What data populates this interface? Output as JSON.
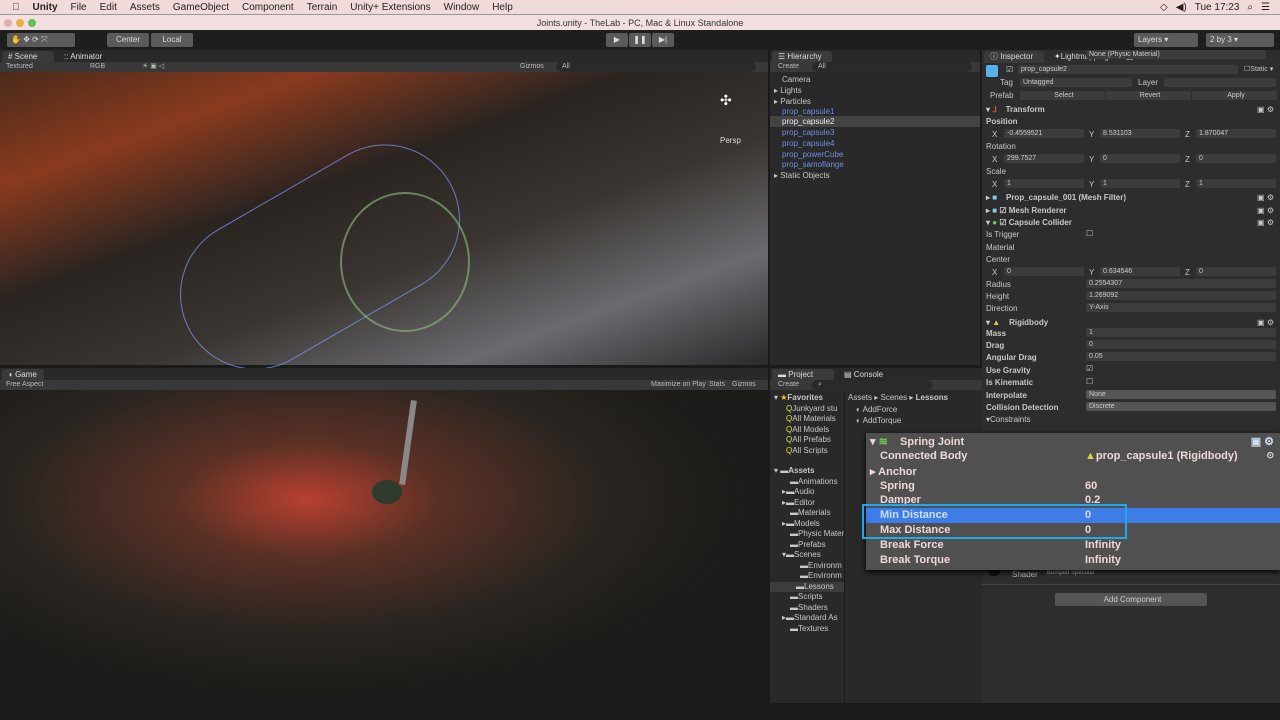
{
  "menu": {
    "apple": "",
    "items": [
      "Unity",
      "File",
      "Edit",
      "Assets",
      "GameObject",
      "Component",
      "Terrain",
      "Unity+ Extensions",
      "Window",
      "Help"
    ],
    "clock": "Tue 17:23"
  },
  "window_title": "Joints.unity - TheLab - PC, Mac & Linux Standalone",
  "toolbar": {
    "center": "Center",
    "local": "Local",
    "layers": "Layers",
    "layout": "2 by 3"
  },
  "scene": {
    "tab": "Scene",
    "tab2": "Animator",
    "shading": "Textured",
    "render": "RGB",
    "gizmos": "Gizmos",
    "search": "All",
    "persp": "Persp"
  },
  "game": {
    "tab": "Game",
    "aspect": "Free Aspect",
    "maximize": "Maximize on Play",
    "stats": "Stats",
    "gizmos": "Gizmos"
  },
  "hierarchy": {
    "tab": "Hierarchy",
    "create": "Create",
    "search": "All",
    "items": [
      {
        "label": "Camera"
      },
      {
        "label": "Lights"
      },
      {
        "label": "Particles"
      },
      {
        "label": "prop_capsule1"
      },
      {
        "label": "prop_capsule2"
      },
      {
        "label": "prop_capsule3"
      },
      {
        "label": "prop_capsule4"
      },
      {
        "label": "prop_powerCube"
      },
      {
        "label": "prop_samoflange"
      },
      {
        "label": "Static Objects"
      }
    ]
  },
  "project": {
    "tab": "Project",
    "tab2": "Console",
    "create": "Create",
    "breadcrumb": [
      "Assets",
      "Scenes",
      "Lessons"
    ],
    "favorites": "Favorites",
    "fav_items": [
      "Junkyard stu",
      "All Materials",
      "All Models",
      "All Prefabs",
      "All Scripts"
    ],
    "assets": "Assets",
    "folders": [
      "Animations",
      "Audio",
      "Editor",
      "Materials",
      "Models",
      "Physic Mater",
      "Prefabs",
      "Scenes",
      "Environm",
      "Environm",
      "Lessons",
      "Scripts",
      "Shaders",
      "Standard As",
      "Textures"
    ],
    "files": [
      "AddForce",
      "AddTorque"
    ]
  },
  "inspector": {
    "tab": "Inspector",
    "tab2": "Lightmapping",
    "tab3": "Occlusion",
    "object_name": "prop_capsule2",
    "static": "Static",
    "tag_label": "Tag",
    "tag": "Untagged",
    "layer_label": "Layer",
    "prefab": "Prefab",
    "select": "Select",
    "revert": "Revert",
    "apply": "Apply",
    "transform": "Transform",
    "position": "Position",
    "rotation": "Rotation",
    "scale": "Scale",
    "pos": [
      "-0.4559521",
      "8.531103",
      "1.870047"
    ],
    "rot": [
      "299.7527",
      "0",
      "0"
    ],
    "scl": [
      "1",
      "1",
      "1"
    ],
    "mesh_filter": "Prop_capsule_001 (Mesh Filter)",
    "mesh_renderer": "Mesh Renderer",
    "capsule_collider": "Capsule Collider",
    "is_trigger": "Is Trigger",
    "material": "Material",
    "material_val": "None (Physic Material)",
    "center": "Center",
    "center_v": [
      "0",
      "0.634546",
      "0"
    ],
    "radius": "Radius",
    "radius_v": "0.2554307",
    "height": "Height",
    "height_v": "1.269092",
    "direction": "Direction",
    "direction_v": "Y-Axis",
    "rigidbody": "Rigidbody",
    "mass": "Mass",
    "mass_v": "1",
    "drag": "Drag",
    "drag_v": "0",
    "ang_drag": "Angular Drag",
    "ang_drag_v": "0.05",
    "use_gravity": "Use Gravity",
    "is_kinematic": "Is Kinematic",
    "interpolate": "Interpolate",
    "interpolate_v": "None",
    "collision": "Collision Detection",
    "collision_v": "Discrete",
    "constraints": "Constraints",
    "shader": "Shader",
    "shader_v": "Bumped Specular",
    "add_component": "Add Component",
    "x": "X",
    "y": "Y",
    "z": "Z"
  },
  "spring_joint": {
    "title": "Spring Joint",
    "connected_body": "Connected Body",
    "connected_body_v": "prop_capsule1 (Rigidbody)",
    "anchor": "Anchor",
    "spring": "Spring",
    "spring_v": "60",
    "damper": "Damper",
    "damper_v": "0.2",
    "min_distance": "Min Distance",
    "min_distance_v": "0",
    "max_distance": "Max Distance",
    "max_distance_v": "0",
    "break_force": "Break Force",
    "break_force_v": "Infinity",
    "break_torque": "Break Torque",
    "break_torque_v": "Infinity"
  },
  "colors": {
    "highlight": "#3e7ce8",
    "outline": "#1fa8ea",
    "prefab_blue": "#6e8fe0"
  }
}
